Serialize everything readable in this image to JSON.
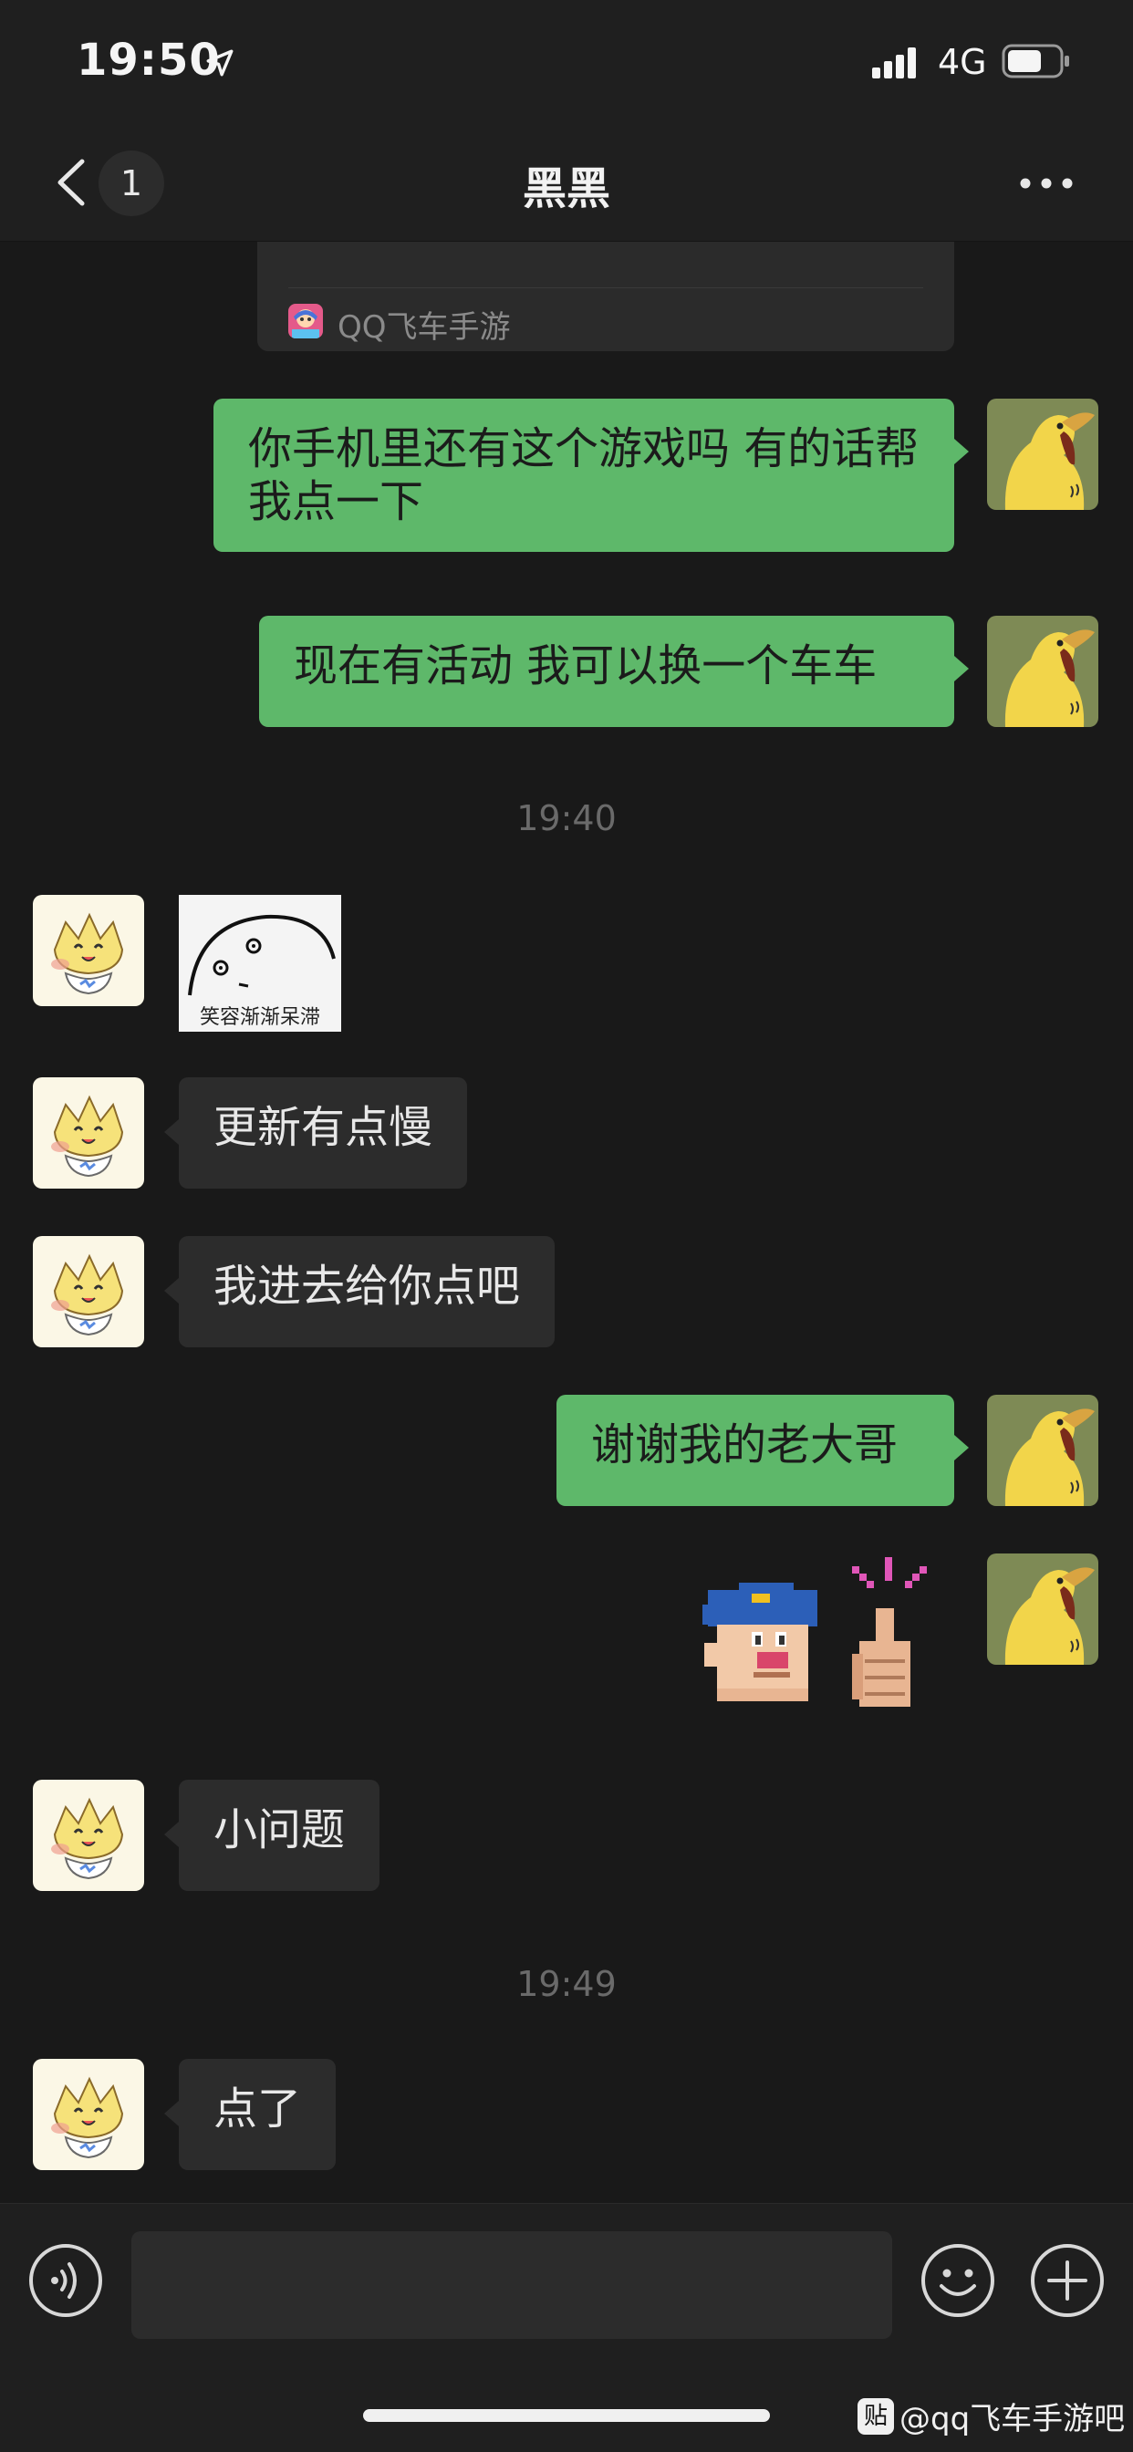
{
  "status_bar": {
    "time": "19:50",
    "network": "4G"
  },
  "nav": {
    "unread_count": "1",
    "title": "黑黑",
    "icons": [
      "back-icon",
      "more-icon"
    ]
  },
  "shared_card": {
    "app_name": "QQ飞车手游"
  },
  "messages": [
    {
      "sender": "me",
      "text": "你手机里还有这个游戏吗 有的话帮我点一下"
    },
    {
      "sender": "me",
      "text": "现在有活动 我可以换一个车车"
    },
    {
      "type": "timestamp",
      "text": "19:40"
    },
    {
      "sender": "them",
      "type": "sticker",
      "caption": "笑容渐渐呆滞"
    },
    {
      "sender": "them",
      "text": "更新有点慢"
    },
    {
      "sender": "them",
      "text": "我进去给你点吧"
    },
    {
      "sender": "me",
      "text": "谢谢我的老大哥"
    },
    {
      "sender": "me",
      "type": "sticker",
      "sticker": "thumbs-up-pixel"
    },
    {
      "sender": "them",
      "text": "小问题"
    },
    {
      "type": "timestamp",
      "text": "19:49"
    },
    {
      "sender": "them",
      "text": "点了"
    }
  ],
  "input_bar": {
    "placeholder": "",
    "icons": [
      "voice-icon",
      "emoji-icon",
      "plus-icon"
    ]
  },
  "watermark": {
    "logo": "贴",
    "text": "@qq飞车手游吧"
  },
  "colors": {
    "background": "#191919",
    "outgoing_bubble": "#5eb86a",
    "incoming_bubble": "#2c2c2c"
  }
}
